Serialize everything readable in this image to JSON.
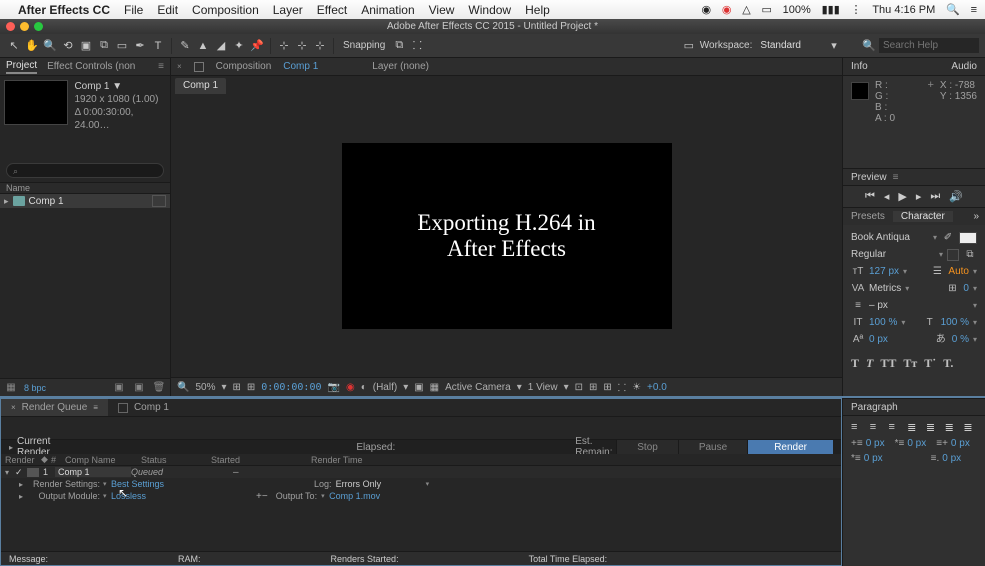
{
  "mac_menu": {
    "app": "After Effects CC",
    "items": [
      "File",
      "Edit",
      "Composition",
      "Layer",
      "Effect",
      "Animation",
      "View",
      "Window",
      "Help"
    ],
    "battery": "100%",
    "time": "Thu 4:16 PM"
  },
  "window_title": "Adobe After Effects CC 2015 - Untitled Project *",
  "toolbar": {
    "snapping": "Snapping",
    "workspace_lbl": "Workspace:",
    "workspace": "Standard",
    "search_ph": "Search Help"
  },
  "project": {
    "tab1": "Project",
    "tab2": "Effect Controls (non",
    "comp_name": "Comp 1 ▼",
    "res": "1920 x 1080 (1.00)",
    "dur": "Δ 0:00:30:00, 24.00…",
    "search_ph": "",
    "name_hdr": "Name",
    "item": "Comp 1",
    "bpc": "8 bpc"
  },
  "composition": {
    "hdr_lbl": "Composition",
    "hdr_link": "Comp 1",
    "layer_lbl": "Layer (none)",
    "tab": "Comp 1",
    "text1": "Exporting H.264 in",
    "text2": "After Effects",
    "zoom": "50%",
    "timecode": "0:00:00:00",
    "quality": "(Half)",
    "camera": "Active Camera",
    "views": "1 View",
    "exposure": "+0.0"
  },
  "info": {
    "tab1": "Info",
    "tab2": "Audio",
    "r": "R :",
    "g": "G :",
    "b": "B :",
    "a": "A : 0",
    "x": "X : -788",
    "y": "Y : 1356"
  },
  "preview": {
    "label": "Preview"
  },
  "character": {
    "tab1": "Presets",
    "tab2": "Character",
    "font": "Book Antiqua",
    "style": "Regular",
    "size": "127 px",
    "leading": "Auto",
    "kerning": "Metrics",
    "tracking": "0",
    "dash": "– px",
    "hscale": "100 %",
    "vscale": "100 %",
    "baseline": "0 px",
    "tsume": "0 %"
  },
  "paragraph": {
    "label": "Paragraph",
    "v1": "0 px",
    "v2": "0 px",
    "v3": "0 px",
    "v4": "0 px",
    "v5": "0 px"
  },
  "render_queue": {
    "tab": "Render Queue",
    "comp_tab": "Comp 1",
    "current": "Current Render",
    "elapsed": "Elapsed:",
    "remain": "Est. Remain:",
    "stop": "Stop",
    "pause": "Pause",
    "render": "Render",
    "h_render": "Render",
    "h_num": "#",
    "h_comp": "Comp Name",
    "h_status": "Status",
    "h_started": "Started",
    "h_rtime": "Render Time",
    "row_num": "1",
    "row_comp": "Comp 1",
    "row_status": "Queued",
    "row_started": "–",
    "rs_lbl": "Render Settings:",
    "rs_val": "Best Settings",
    "om_lbl": "Output Module:",
    "om_val": "Lossless",
    "log_lbl": "Log:",
    "log_val": "Errors Only",
    "out_lbl": "Output To:",
    "out_val": "Comp 1.mov",
    "f1": "Message:",
    "f2": "RAM:",
    "f3": "Renders Started:",
    "f4": "Total Time Elapsed:"
  }
}
